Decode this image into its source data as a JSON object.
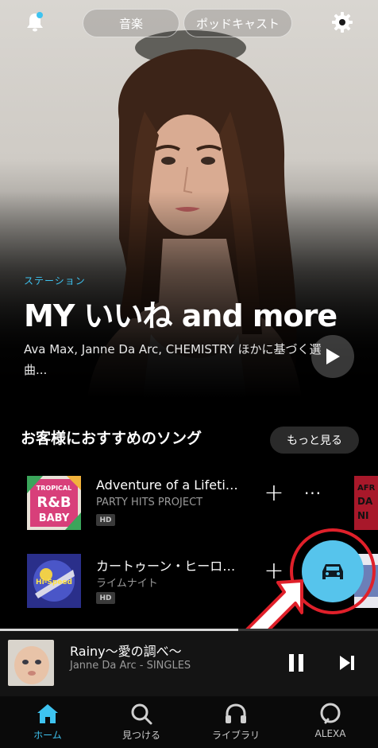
{
  "colors": {
    "accent": "#3ec3f0",
    "fab": "#56c4ec",
    "annotation": "#e0202a"
  },
  "header": {
    "tabs": [
      {
        "label": "音楽"
      },
      {
        "label": "ポッドキャスト"
      }
    ],
    "icons": {
      "notifications": "bell-icon",
      "settings": "gear-icon"
    }
  },
  "hero": {
    "kind": "ステーション",
    "title": "MY いいね and more",
    "description": "Ava Max, Janne Da Arc, CHEMISTRY ほかに基づく選曲...",
    "play_icon": "play-icon"
  },
  "recommended": {
    "title": "お客様におすすめのソング",
    "more_label": "もっと見る",
    "songs": [
      {
        "title": "Adventure of a Lifetime",
        "artist": "PARTY HITS PROJECT",
        "badge": "HD",
        "art_text": "TROPICAL R&B BABY"
      },
      {
        "title": "カートゥーン・ヒーローズ",
        "artist": "ライムナイト",
        "badge": "HD"
      }
    ],
    "add_label": "+",
    "more_actions_label": "···"
  },
  "car_mode": {
    "icon": "car-icon"
  },
  "now_playing": {
    "title": "Rainy〜愛の調べ〜",
    "artist": "Janne Da Arc - SINGLES",
    "progress": 0.63
  },
  "nav": [
    {
      "label": "ホーム",
      "icon": "home-icon",
      "active": true
    },
    {
      "label": "見つける",
      "icon": "search-icon"
    },
    {
      "label": "ライブラリ",
      "icon": "headphones-icon"
    },
    {
      "label": "ALEXA",
      "icon": "alexa-icon"
    }
  ]
}
